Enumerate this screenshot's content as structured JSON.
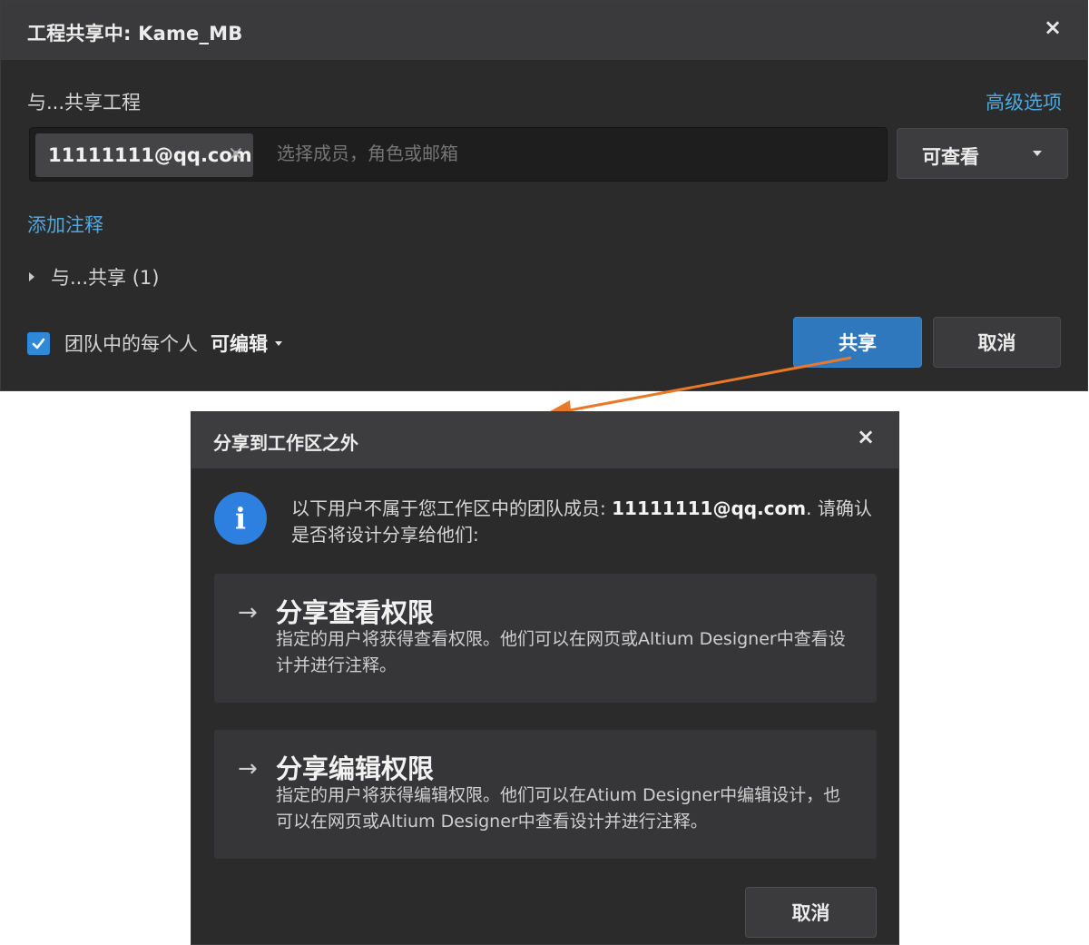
{
  "share_dialog": {
    "title": "工程共享中: Kame_MB",
    "close_glyph": "×",
    "share_with_label": "与...共享工程",
    "advanced_options": "高级选项",
    "member_input": {
      "chip_value": "11111111@qq.com",
      "chip_remove_glyph": "×",
      "placeholder": "选择成员，角色或邮箱"
    },
    "permission_select": {
      "value": "可查看"
    },
    "add_note": "添加注释",
    "shared_with_toggle": "与...共享 (1)",
    "team_row": {
      "checked": true,
      "label": "团队中的每个人",
      "permission": "可编辑"
    },
    "share_button": "共享",
    "cancel_button": "取消"
  },
  "external_dialog": {
    "title": "分享到工作区之外",
    "close_glyph": "×",
    "info_icon": "info-icon",
    "info_message_before": "以下用户不属于您工作区中的团队成员: ",
    "info_email": "11111111@qq.com",
    "info_message_after": ". 请确认是否将设计分享给他们:",
    "options": [
      {
        "arrow": "→",
        "title": "分享查看权限",
        "description": "指定的用户将获得查看权限。他们可以在网页或Altium Designer中查看设计并进行注释。"
      },
      {
        "arrow": "→",
        "title": "分享编辑权限",
        "description": "指定的用户将获得编辑权限。他们可以在Atium Designer中编辑设计，也可以在网页或Altium Designer中查看设计并进行注释。"
      }
    ],
    "cancel_button": "取消"
  },
  "colors": {
    "dialog_bg": "#2b2b2c",
    "header_bg": "#3a3a3c",
    "link_blue": "#4fa8e0",
    "primary_button": "#2f78bd",
    "info_blue": "#2d7fe0",
    "arrow_orange": "#e8782a"
  }
}
